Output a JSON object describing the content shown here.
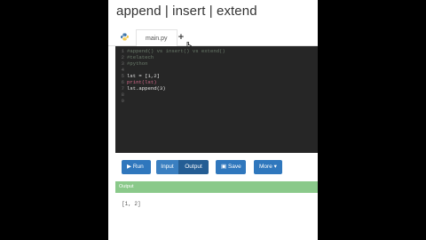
{
  "page": {
    "title": "append | insert | extend"
  },
  "tabs": {
    "file_name": "main.py",
    "add_label": "+"
  },
  "editor": {
    "lines": [
      {
        "num": "1",
        "text": "#append() vs insert() vs extend()"
      },
      {
        "num": "2",
        "text": "#telatech"
      },
      {
        "num": "3",
        "text": "#python"
      },
      {
        "num": "4",
        "text": ""
      },
      {
        "num": "5",
        "text": "lst = [1,2]"
      },
      {
        "num": "6",
        "text": "print(lst)"
      },
      {
        "num": "7",
        "text": "lst.append(3)"
      },
      {
        "num": "8",
        "text": ""
      },
      {
        "num": "9",
        "text": ""
      }
    ]
  },
  "toolbar": {
    "run_label": "Run",
    "input_label": "Input",
    "output_label": "Output",
    "save_label": "Save",
    "more_label": "More"
  },
  "output": {
    "header": "Output",
    "text": "[1, 2]"
  },
  "colors": {
    "accent": "#2f77bd",
    "output_header": "#8ac98a",
    "editor_bg": "#262626"
  }
}
